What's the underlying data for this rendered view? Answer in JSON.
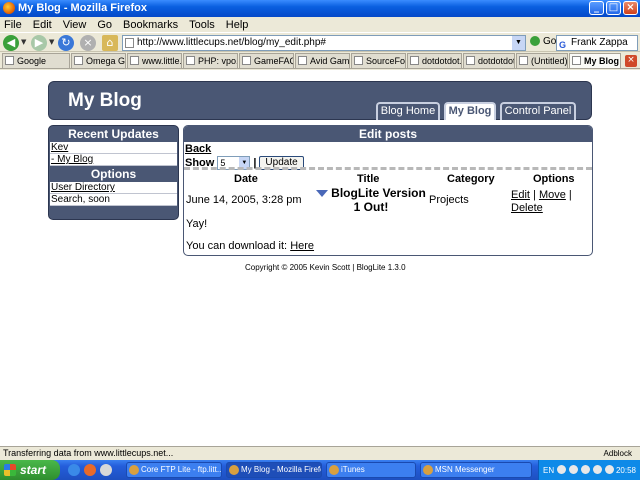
{
  "window": {
    "title": "My Blog - Mozilla Firefox"
  },
  "menu": [
    "File",
    "Edit",
    "View",
    "Go",
    "Bookmarks",
    "Tools",
    "Help"
  ],
  "navbar": {
    "url": "http://www.littlecups.net/blog/my_edit.php#",
    "go_label": "Go",
    "search_value": "Frank Zappa"
  },
  "tabs": [
    {
      "label": "Google"
    },
    {
      "label": "Omega G..."
    },
    {
      "label": "www.little..."
    },
    {
      "label": "PHP: vpo..."
    },
    {
      "label": "GameFAQ..."
    },
    {
      "label": "Avid Gam..."
    },
    {
      "label": "SourceFo..."
    },
    {
      "label": "dotdotdot..."
    },
    {
      "label": "dotdotdot..."
    },
    {
      "label": "(Untitled)"
    },
    {
      "label": "My Blog"
    }
  ],
  "page": {
    "site_title": "My Blog",
    "nav": {
      "home": "Blog Home",
      "my_blog": "My Blog",
      "control_panel": "Control Panel"
    },
    "sidebar": {
      "recent_heading": "Recent Updates",
      "recent_items": [
        "Kev",
        "- My Blog"
      ],
      "options_heading": "Options",
      "options_items": [
        "User Directory",
        "Search, soon"
      ]
    },
    "edit": {
      "heading": "Edit posts",
      "back": "Back",
      "show_label": "Show",
      "show_value": "5",
      "separator": "|",
      "update_button": "Update",
      "columns": {
        "date": "Date",
        "title": "Title",
        "category": "Category",
        "options": "Options"
      },
      "post": {
        "date": "June 14, 2005, 3:28 pm",
        "title": "BlogLite Version 1 Out!",
        "category": "Projects",
        "edit": "Edit",
        "move": "Move",
        "delete": "Delete",
        "sep": "|",
        "body": "Yay!",
        "download_text": "You can download it:",
        "download_link": "Here"
      }
    },
    "copyright": "Copyright © 2005 Kevin Scott | BlogLite 1.3.0"
  },
  "status": {
    "text": "Transferring data from www.littlecups.net...",
    "adblock": "Adblock"
  },
  "taskbar": {
    "start": "start",
    "items": [
      {
        "label": "Core FTP Lite - ftp.litt..."
      },
      {
        "label": "My Blog - Mozilla Firefox"
      },
      {
        "label": "iTunes"
      },
      {
        "label": "MSN Messenger"
      }
    ],
    "lang": "EN",
    "clock": "20:58"
  }
}
